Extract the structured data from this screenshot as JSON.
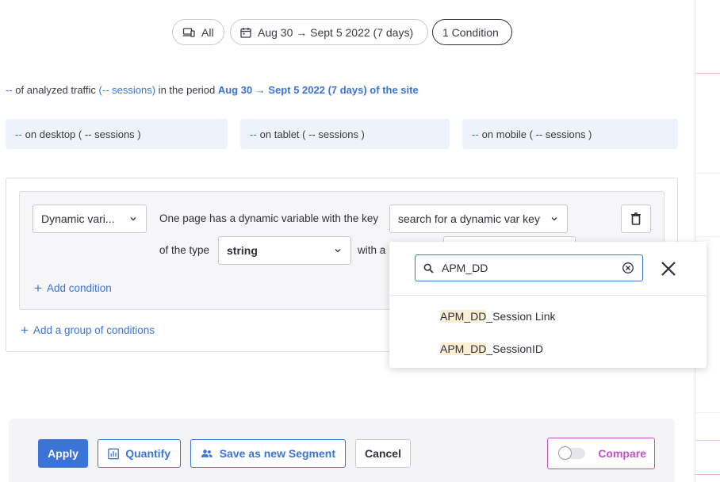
{
  "filters": {
    "device": "All",
    "date_range": "Aug 30 → Sept 5 2022 (7 days)",
    "conditions": "1 Condition"
  },
  "summary": {
    "part1": "--",
    "part2": " of analyzed traffic ",
    "part3": "(-- sessions)",
    "part4": " in the period ",
    "part5": "Aug 30 → Sept 5 2022 (7 days) of the site"
  },
  "devices": [
    {
      "prefix": "--",
      "label": "on desktop ( -- sessions )"
    },
    {
      "prefix": "--",
      "label": "on tablet ( -- sessions )"
    },
    {
      "prefix": "--",
      "label": "on mobile ( -- sessions )"
    }
  ],
  "condition": {
    "criteria_select": "Dynamic vari...",
    "text_key": "One page has a dynamic variable with the key",
    "key_select": "search for a dynamic var key",
    "text_type": "of the type",
    "type_select": "string",
    "text_with": "with a",
    "add_condition": "Add condition",
    "add_group": "Add a group of conditions"
  },
  "dropdown": {
    "search_value": "APM_DD",
    "options": [
      {
        "match": "APM_DD",
        "rest": "_Session Link"
      },
      {
        "match": "APM_DD",
        "rest": "_SessionID"
      }
    ]
  },
  "footer": {
    "apply": "Apply",
    "quantify": "Quantify",
    "save_segment": "Save as new Segment",
    "cancel": "Cancel",
    "compare": "Compare"
  },
  "colors": {
    "accent": "#3b73d6",
    "compare": "#c64fc6",
    "highlight": "#fbefd6"
  }
}
